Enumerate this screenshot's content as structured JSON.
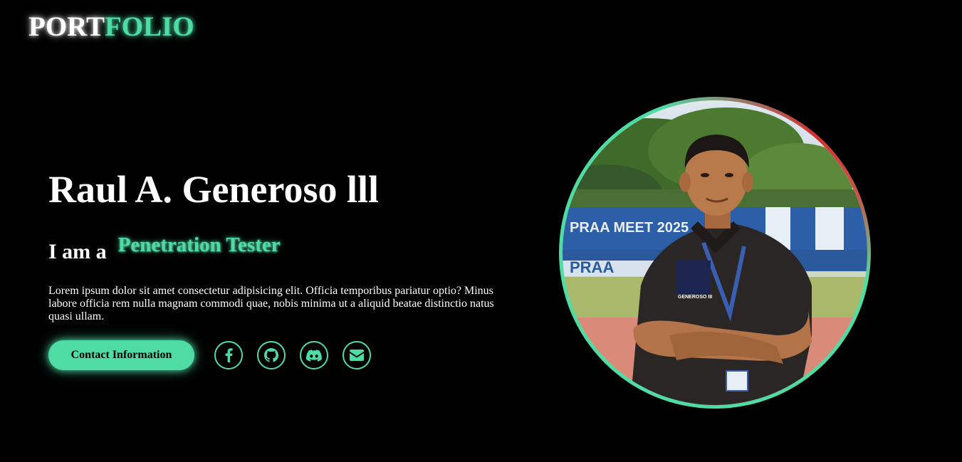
{
  "header": {
    "logo_part1": "PORT",
    "logo_part2": "FOLIO"
  },
  "hero": {
    "name": "Raul A. Generoso lll",
    "role_prefix": "I am a",
    "role": "Penetration Tester",
    "description": "Lorem ipsum dolor sit amet consectetur adipisicing elit. Officia temporibus pariatur optio? Minus labore officia rem nulla magnam commodi quae, nobis minima ut a aliquid beatae distinctio natus quasi ullam.",
    "contact_button": "Contact Information",
    "socials": [
      {
        "icon": "facebook-icon"
      },
      {
        "icon": "github-icon"
      },
      {
        "icon": "discord-icon"
      },
      {
        "icon": "envelope-icon"
      }
    ]
  },
  "photo": {
    "shirt_badge_text": "GENEROSO III",
    "banner_text_1": "PRAA MEET 2025",
    "banner_text_2": "PRAA"
  },
  "colors": {
    "accent": "#4fdba4",
    "background": "#000000",
    "text": "#ffffff"
  }
}
